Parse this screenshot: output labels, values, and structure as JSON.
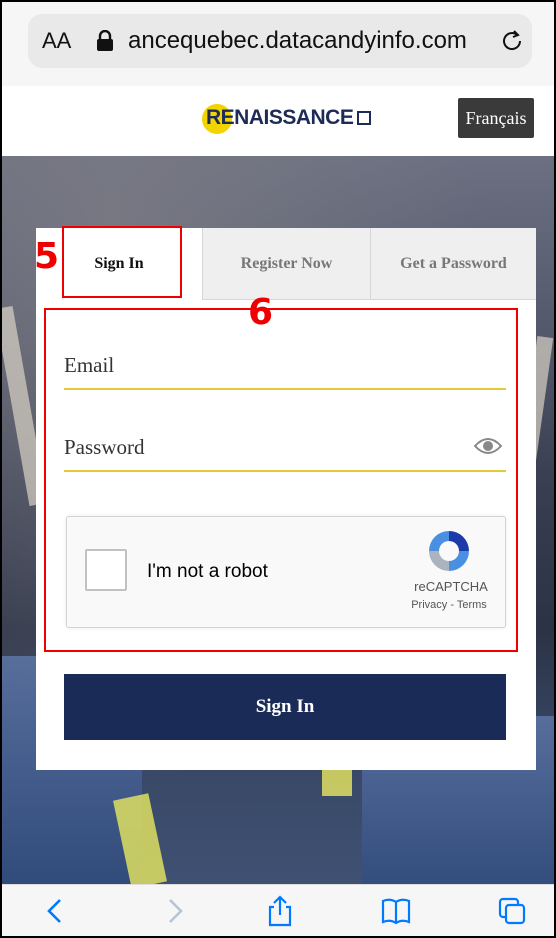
{
  "browser": {
    "text_size_label": "AA",
    "url": "ancequebec.datacandyinfo.com",
    "accent_color": "#007aff"
  },
  "header": {
    "logo_text": "RENAISSANCE",
    "language_button": "Français"
  },
  "tabs": [
    {
      "label": "Sign In",
      "active": true
    },
    {
      "label": "Register Now",
      "active": false
    },
    {
      "label": "Get a Password",
      "active": false
    }
  ],
  "form": {
    "email_placeholder": "Email",
    "password_placeholder": "Password",
    "captcha": {
      "label": "I'm not a robot",
      "brand": "reCAPTCHA",
      "links": "Privacy - Terms"
    },
    "submit_label": "Sign In"
  },
  "annotations": {
    "step_5": "5",
    "step_6": "6",
    "color": "#e00000"
  },
  "colors": {
    "primary_navy": "#1b2b57",
    "field_underline": "#e3c93a",
    "logo_yellow": "#f2d400"
  }
}
